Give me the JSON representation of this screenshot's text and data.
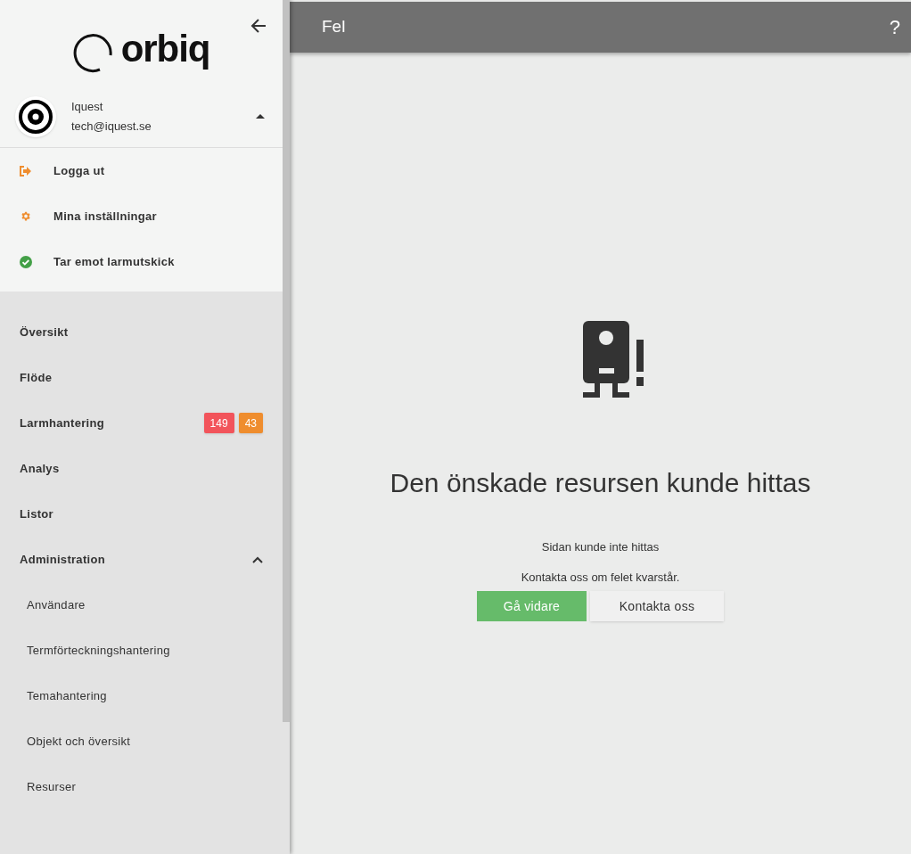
{
  "sidebar": {
    "logo_text": "orbiq",
    "user": {
      "name": "Iquest",
      "email": "tech@iquest.se",
      "expanded": true
    },
    "account_items": [
      {
        "label": "Logga ut",
        "kind": "logout"
      },
      {
        "label": "Mina inställningar",
        "kind": "settings"
      },
      {
        "label": "Tar emot larmutskick",
        "kind": "status"
      }
    ],
    "nav_items": [
      {
        "label": "Översikt"
      },
      {
        "label": "Flöde"
      },
      {
        "label": "Larmhantering",
        "badges": [
          {
            "text": "149",
            "color": "#f2545b"
          },
          {
            "text": "43",
            "color": "#ef8d2e"
          }
        ]
      },
      {
        "label": "Analys"
      },
      {
        "label": "Listor"
      },
      {
        "label": "Administration",
        "expanded": true,
        "children": [
          {
            "label": "Användare"
          },
          {
            "label": "Termförteckningshantering"
          },
          {
            "label": "Temahantering"
          },
          {
            "label": "Objekt och översikt"
          },
          {
            "label": "Resurser"
          }
        ]
      }
    ]
  },
  "header": {
    "title": "Fel",
    "help": "?"
  },
  "error": {
    "heading": "Den önskade resursen kunde hittas",
    "lines": [
      "Sidan kunde inte hittas",
      "Kontakta oss om felet kvarstår."
    ],
    "buttons": [
      {
        "label": "Gå vidare",
        "kind": "primary"
      },
      {
        "label": "Kontakta oss",
        "kind": "secondary"
      }
    ]
  }
}
